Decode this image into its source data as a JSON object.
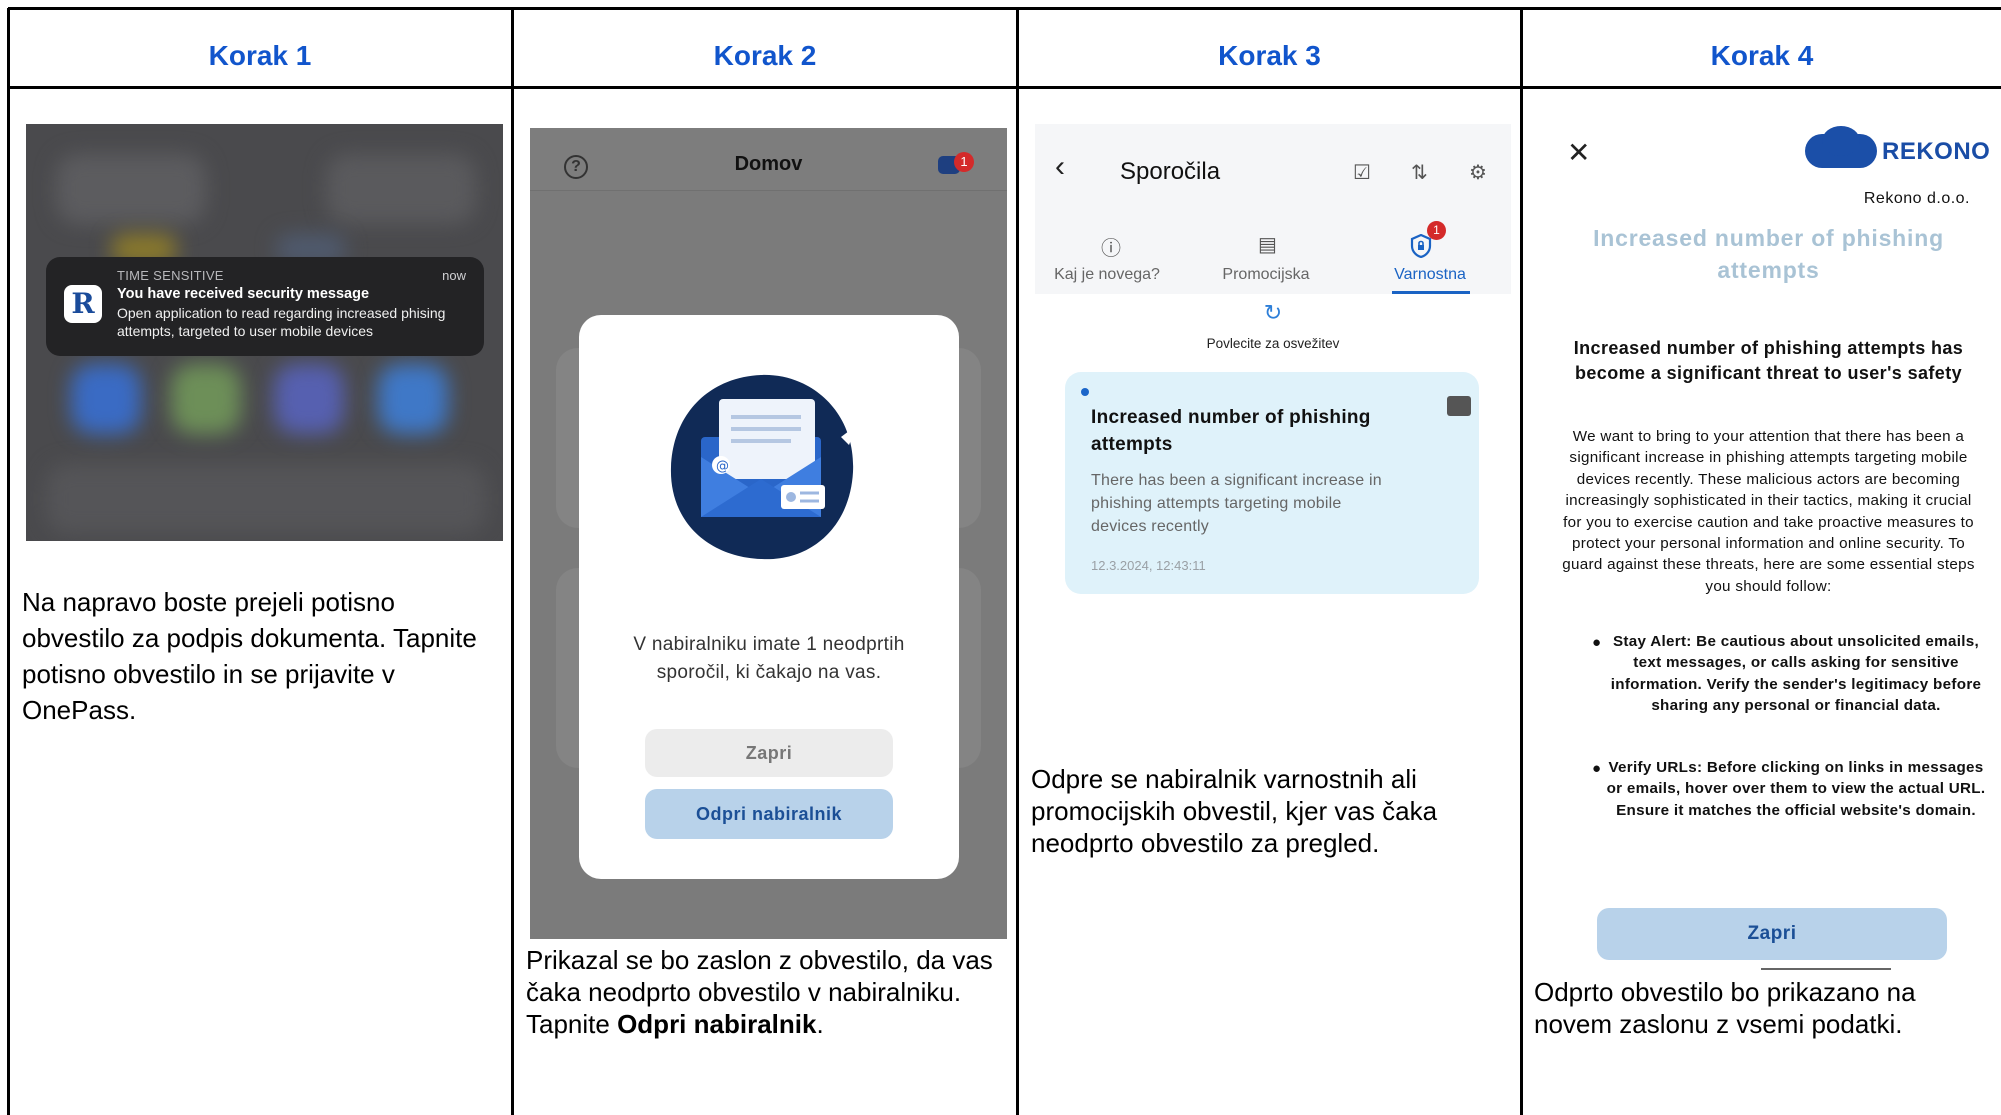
{
  "headers": [
    "Korak 1",
    "Korak 2",
    "Korak 3",
    "Korak 4"
  ],
  "step1": {
    "notification": {
      "category": "TIME SENSITIVE",
      "time": "now",
      "title": "You have received security message",
      "body": "Open application to read regarding increased phising attempts, targeted to user mobile devices",
      "icon": "rekono-app-icon"
    },
    "caption": "Na napravo boste prejeli potisno obvestilo za podpis dokumenta. Tapnite potisno obvestilo in se prijavite v OnePass."
  },
  "step2": {
    "screen_title": "Domov",
    "badge_count": "1",
    "modal_message": "V nabiralniku imate 1 neodprtih sporočil, ki čakajo na vas.",
    "close_button": "Zapri",
    "open_button": "Odpri nabiralnik",
    "caption_prefix": "Prikazal se bo zaslon z obvestilo, da vas čaka neodprto obvestilo v nabiralniku. Tapnite ",
    "caption_bold": "Odpri nabiralnik",
    "caption_suffix": "."
  },
  "step3": {
    "screen_title": "Sporočila",
    "tabs": [
      {
        "label": "Kaj je novega?",
        "icon": "alert-circle-icon"
      },
      {
        "label": "Promocijska",
        "icon": "newspaper-icon"
      },
      {
        "label": "Varnostna",
        "icon": "shield-lock-icon",
        "active": true,
        "badge": "1"
      }
    ],
    "pull_to_refresh": "Povlecite za osvežitev",
    "message": {
      "title": "Increased number of phishing attempts",
      "preview": "There has been a significant increase in phishing attempts targeting mobile devices recently",
      "date": "12.3.2024, 12:43:11"
    },
    "caption": "Odpre se nabiralnik varnostnih ali promocijskih obvestil, kjer vas čaka neodprto obvestilo za pregled."
  },
  "step4": {
    "brand": "REKONO",
    "company": "Rekono d.o.o.",
    "title": "Increased number of phishing attempts",
    "subtitle": "Increased number of phishing attempts has become a significant threat to user's safety",
    "paragraph": "We want to bring to your attention that there has been a significant increase in phishing attempts targeting mobile devices recently. These malicious actors are becoming increasingly sophisticated in their tactics, making it crucial for you to exercise caution and take proactive measures to protect your personal information and online security. To guard against these threats, here are some essential steps you should follow:",
    "bullets": [
      "Stay Alert: Be cautious about unsolicited emails, text messages, or calls asking for sensitive information. Verify the sender's legitimacy before sharing any personal or financial data.",
      "Verify URLs: Before clicking on links in messages or emails, hover over them to view the actual URL. Ensure it matches the official website's domain."
    ],
    "close_button": "Zapri",
    "caption": "Odprto obvestilo bo prikazano na novem zaslonu z vsemi podatki."
  }
}
